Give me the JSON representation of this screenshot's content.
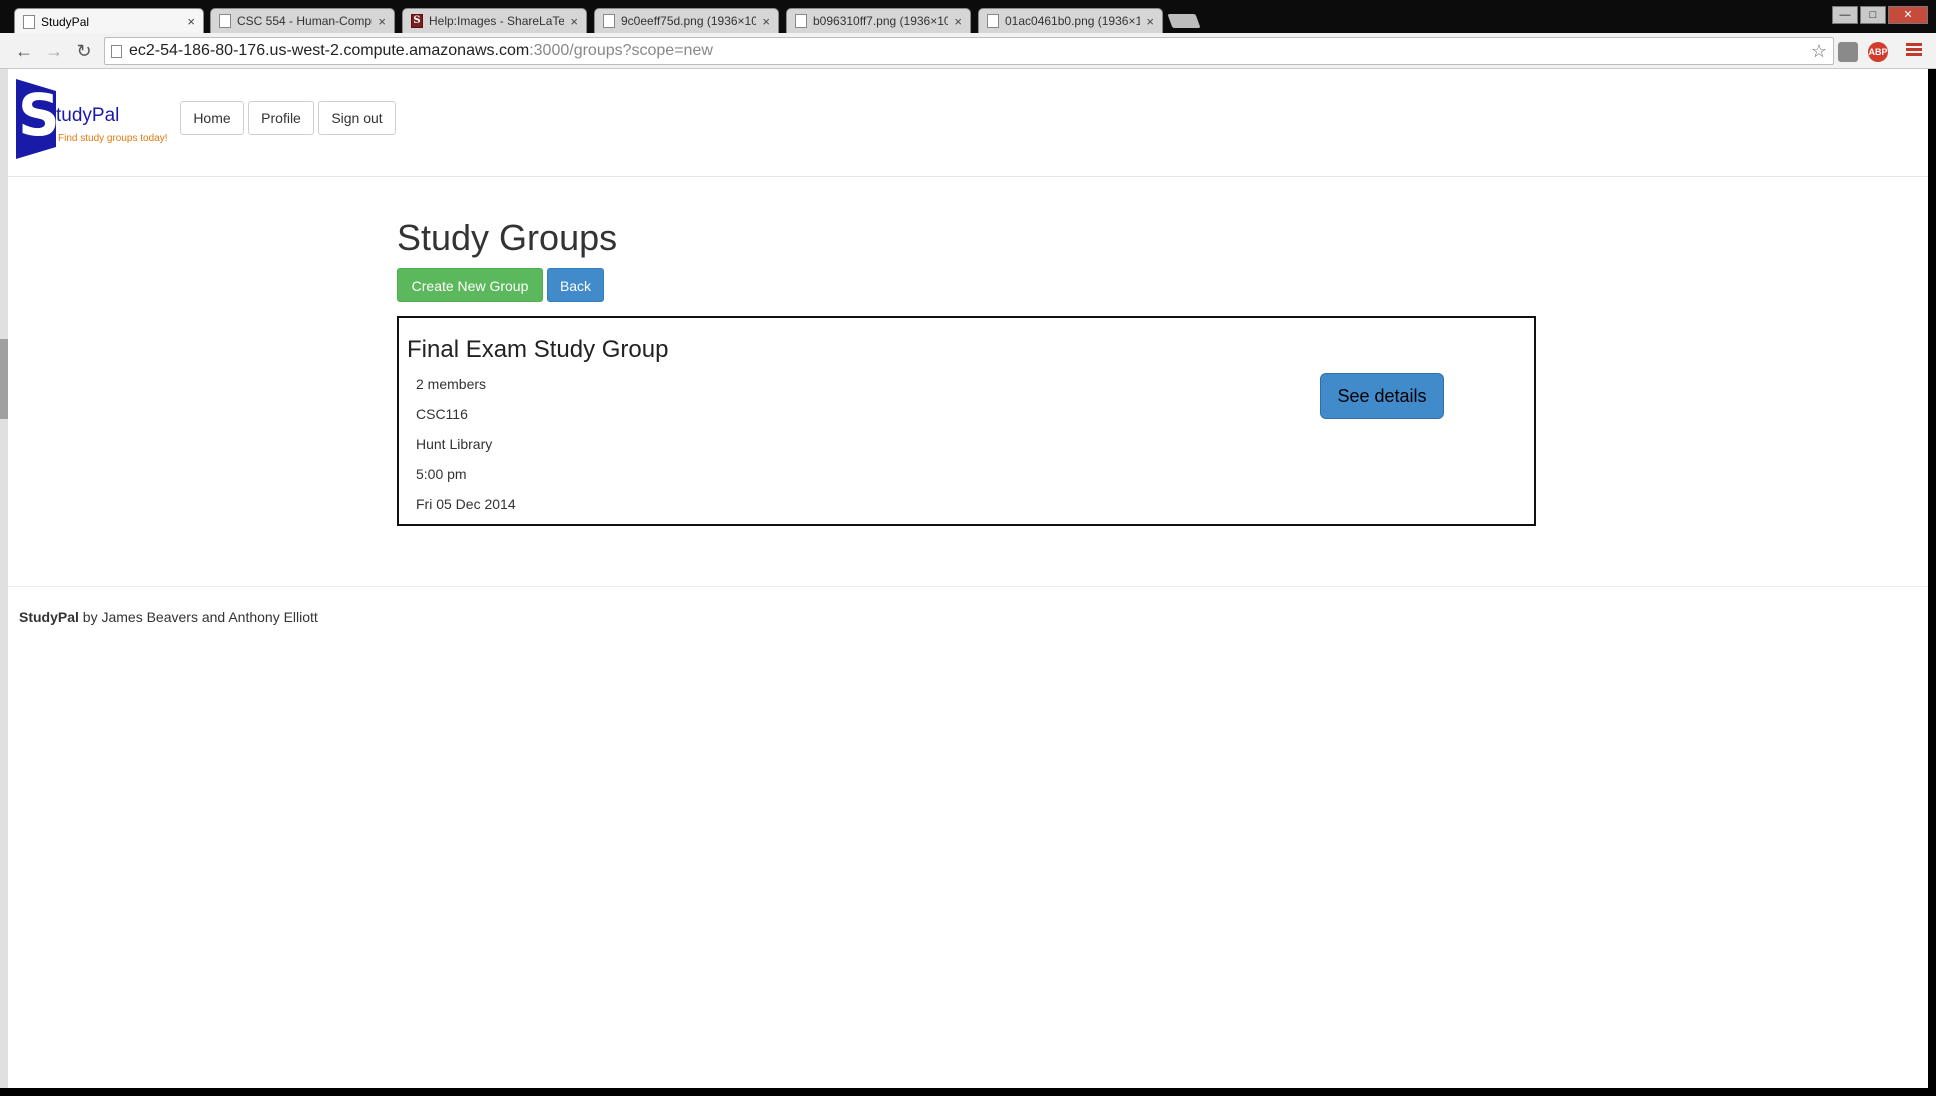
{
  "browser": {
    "tabs": [
      {
        "label": "StudyPal",
        "active": true
      },
      {
        "label": "CSC 554 - Human-Compu",
        "active": false
      },
      {
        "label": "Help:Images - ShareLaTeX",
        "active": false
      },
      {
        "label": "9c0eeff75d.png (1936×109",
        "active": false
      },
      {
        "label": "b096310ff7.png (1936×109",
        "active": false
      },
      {
        "label": "01ac0461b0.png (1936×10",
        "active": false
      }
    ],
    "tab_close_glyph": "×",
    "url_host": "ec2-54-186-80-176.us-west-2.compute.amazonaws.com",
    "url_rest": ":3000/groups?scope=new",
    "ext_abp": "ABP"
  },
  "header": {
    "logo_letter": "S",
    "logo_name": "tudyPal",
    "logo_tagline": "Find study groups today!",
    "nav": {
      "home": "Home",
      "profile": "Profile",
      "sign_out": "Sign out"
    }
  },
  "main": {
    "title": "Study Groups",
    "create_label": "Create New Group",
    "back_label": "Back",
    "groups": [
      {
        "name": "Final Exam Study Group",
        "members": "2 members",
        "course": "CSC116",
        "location": "Hunt Library",
        "time": "5:00 pm",
        "date": "Fri 05 Dec 2014",
        "details_label": "See details"
      }
    ]
  },
  "footer": {
    "brand": "StudyPal",
    "credit": " by James Beavers and Anthony Elliott"
  },
  "colors": {
    "brand_blue": "#1a1aa8",
    "tagline_orange": "#e07b10",
    "success": "#5cb85c",
    "primary": "#428bca"
  }
}
